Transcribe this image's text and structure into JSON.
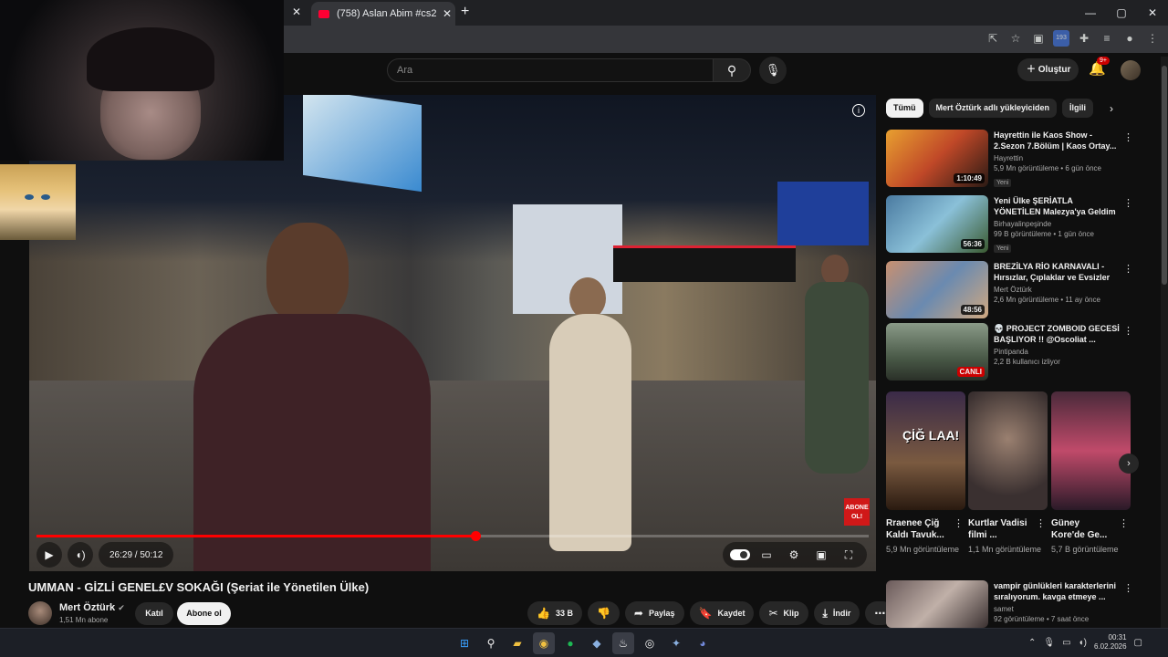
{
  "browser": {
    "tab_title": "(758) Aslan Abim #cs2 - YouTube",
    "new_tab": "+",
    "window_controls": [
      "—",
      "▢",
      "✕"
    ],
    "ext_badge": "193"
  },
  "header": {
    "search_placeholder": "Ara",
    "create_label": "Oluştur",
    "notif_badge": "9+"
  },
  "player": {
    "time_current": "26:29",
    "time_total": "50:12",
    "time_display": "26:29 / 50:12",
    "progress_fraction": 0.527,
    "overlay_badge": "ABONE OL!"
  },
  "video": {
    "title": "UMMAN - GİZLİ GENEL£V SOKAĞI (Şeriat ile Yönetilen Ülke)",
    "channel": "Mert Öztürk",
    "subscribers": "1,51 Mn abone",
    "join_label": "Katıl",
    "subscribe_label": "Abone ol",
    "likes": "33 B",
    "share_label": "Paylaş",
    "save_label": "Kaydet",
    "clip_label": "Klip",
    "download_label": "İndir"
  },
  "sidebar": {
    "chips": [
      "Tümü",
      "Mert Öztürk adlı yükleyiciden",
      "İlgili"
    ],
    "recs": [
      {
        "title": "Hayrettin ile Kaos Show - 2.Sezon 7.Bölüm | Kaos Ortay...",
        "channel": "Hayrettin",
        "stats": "5,9 Mn görüntüleme • 6 gün önce",
        "badge": "Yeni",
        "duration": "1:10:49"
      },
      {
        "title": "Yeni Ülke ŞERİATLA YÖNETİLEN Malezya'ya Geldim - İşte Kuala...",
        "channel": "Birhayalinpeşinde",
        "stats": "99 B görüntüleme • 1 gün önce",
        "badge": "Yeni",
        "duration": "56:36"
      },
      {
        "title": "BREZİLYA RİO KARNAVALI - Hırsızlar, Çıplaklar ve Evsizler",
        "channel": "Mert Öztürk",
        "stats": "2,6 Mn görüntüleme • 11 ay önce",
        "badge": "",
        "duration": "48:56"
      },
      {
        "title": "💀 PROJECT ZOMBOID GECESİ BAŞLIYOR !! @Oscoliat ...",
        "channel": "Pintipanda",
        "stats": "2,2 B kullanıcı izliyor",
        "badge": "",
        "duration": "CANLI"
      }
    ],
    "shorts": [
      {
        "title": "Rraenee Çiğ Kaldı Tavuk...",
        "views": "5,9 Mn görüntüleme",
        "caption": "ÇİĞ LAA!"
      },
      {
        "title": "Kurtlar Vadisi filmi ...",
        "views": "1,1 Mn görüntüleme",
        "caption": ""
      },
      {
        "title": "Güney Kore'de Ge...",
        "views": "5,7 B görüntüleme",
        "caption": ""
      }
    ],
    "rec5": {
      "title": "vampir günlükleri karakterlerini sıralıyorum. kavga etmeye ...",
      "channel": "samet",
      "stats": "92 görüntüleme • 7 saat önce"
    }
  },
  "taskbar": {
    "time": "00:31",
    "date": "6.02.2026"
  },
  "colors": {
    "accent": "#ff0000",
    "bg": "#0f0f0f",
    "chip": "#272727"
  }
}
